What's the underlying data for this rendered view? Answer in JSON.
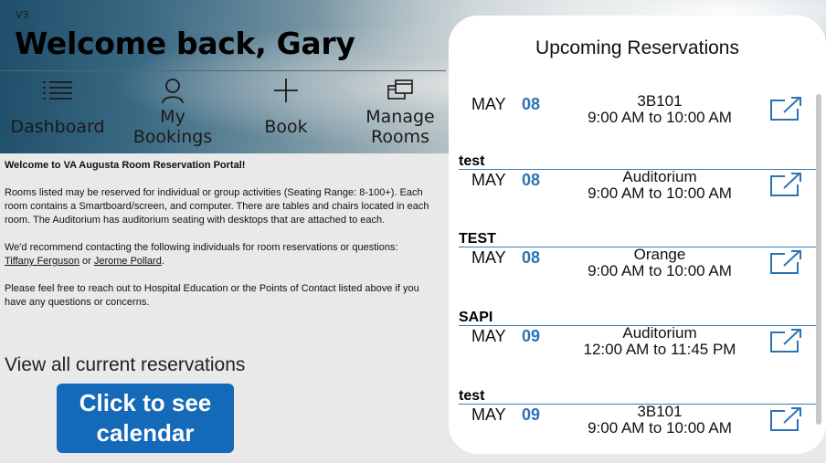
{
  "header": {
    "version": "V3",
    "welcome": "Welcome back, Gary"
  },
  "nav": [
    {
      "label": "Dashboard",
      "icon": "list-icon"
    },
    {
      "label": "My Bookings",
      "icon": "person-icon"
    },
    {
      "label": "Book",
      "icon": "plus-icon"
    },
    {
      "label": "Manage Rooms",
      "icon": "manage-rooms-icon"
    }
  ],
  "intro": {
    "heading": "Welcome to VA Augusta Room Reservation Portal!",
    "para1": "Rooms listed may be reserved for individual or group activities (Seating Range: 8-100+). Each room contains a Smartboard/screen, and computer. There are tables and chairs located in each room. The Auditorium has auditorium seating with desktops that are attached to each.",
    "para2_prefix": "We'd recommend contacting the following individuals for room reservations or questions:",
    "contact1": "Tiffany Ferguson",
    "or": "or",
    "contact2": "Jerome Pollard",
    "period": ".",
    "para3": "Please feel free to reach out to Hospital Education or the Points of Contact listed above if you have any questions or concerns."
  },
  "view_all": "View all current reservations",
  "calendar_button": "Click to see calendar",
  "panel": {
    "title": "Upcoming Reservations",
    "reservations": [
      {
        "name": "",
        "month": "MAY",
        "day": "08",
        "room": "3B101",
        "time": "9:00 AM to 10:00 AM"
      },
      {
        "name": "test",
        "month": "MAY",
        "day": "08",
        "room": "Auditorium",
        "time": "9:00 AM to 10:00 AM"
      },
      {
        "name": "TEST",
        "month": "MAY",
        "day": "08",
        "room": "Orange",
        "time": "9:00 AM to 10:00 AM"
      },
      {
        "name": "SAPI",
        "month": "MAY",
        "day": "09",
        "room": "Auditorium",
        "time": "12:00 AM to 11:45 PM"
      },
      {
        "name": "test",
        "month": "MAY",
        "day": "09",
        "room": "3B101",
        "time": "9:00 AM to 10:00 AM"
      }
    ]
  },
  "colors": {
    "accent": "#2b73b6",
    "button": "#1469b9"
  }
}
